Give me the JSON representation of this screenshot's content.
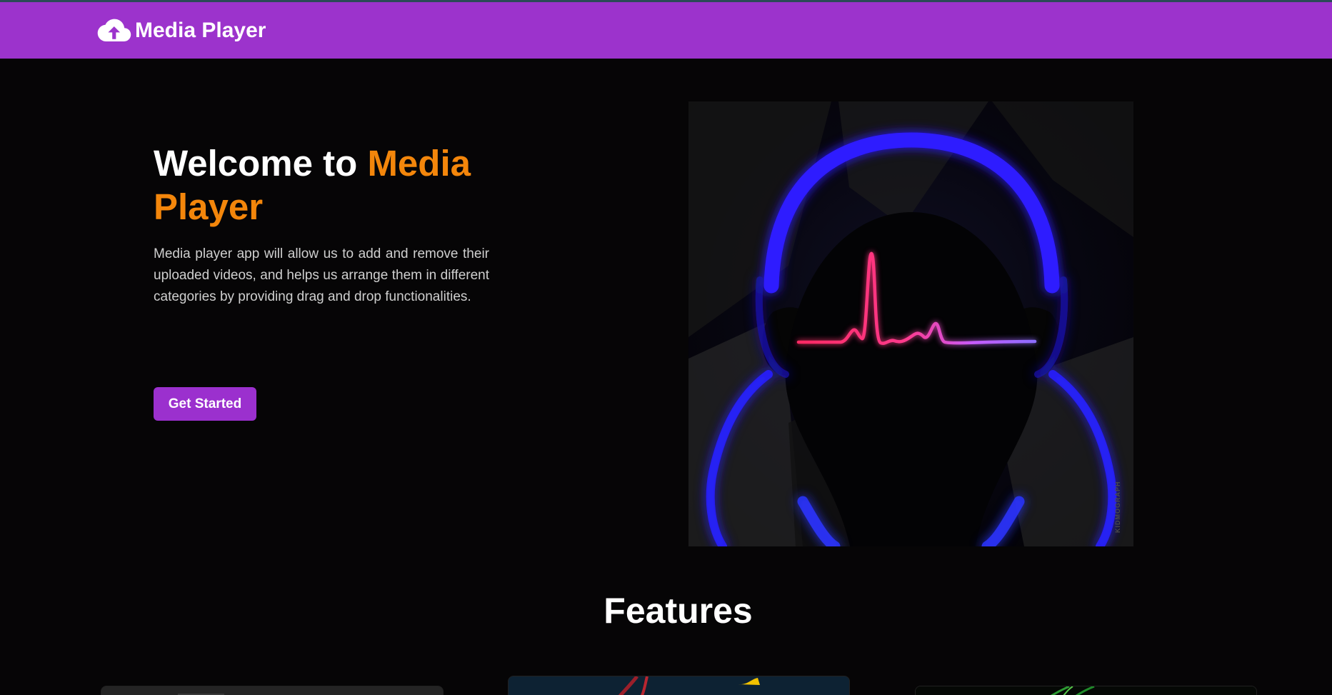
{
  "colors": {
    "navbar": "#9c33cc",
    "background": "#060506",
    "accent_orange": "#f3860b",
    "button": "#9b30ce",
    "text_muted": "#cfcfcf"
  },
  "navbar": {
    "brand_icon": "cloud-upload-icon",
    "brand_title": "Media Player"
  },
  "hero": {
    "title_prefix": "Welcome to ",
    "title_accent": "Media Player",
    "description": "Media player app will allow us to add and remove their uploaded videos, and helps us arrange them in different categories by providing drag and drop functionalities.",
    "cta_label": "Get Started",
    "image_watermark": "KIDMOGRAPH"
  },
  "features": {
    "heading": "Features"
  }
}
